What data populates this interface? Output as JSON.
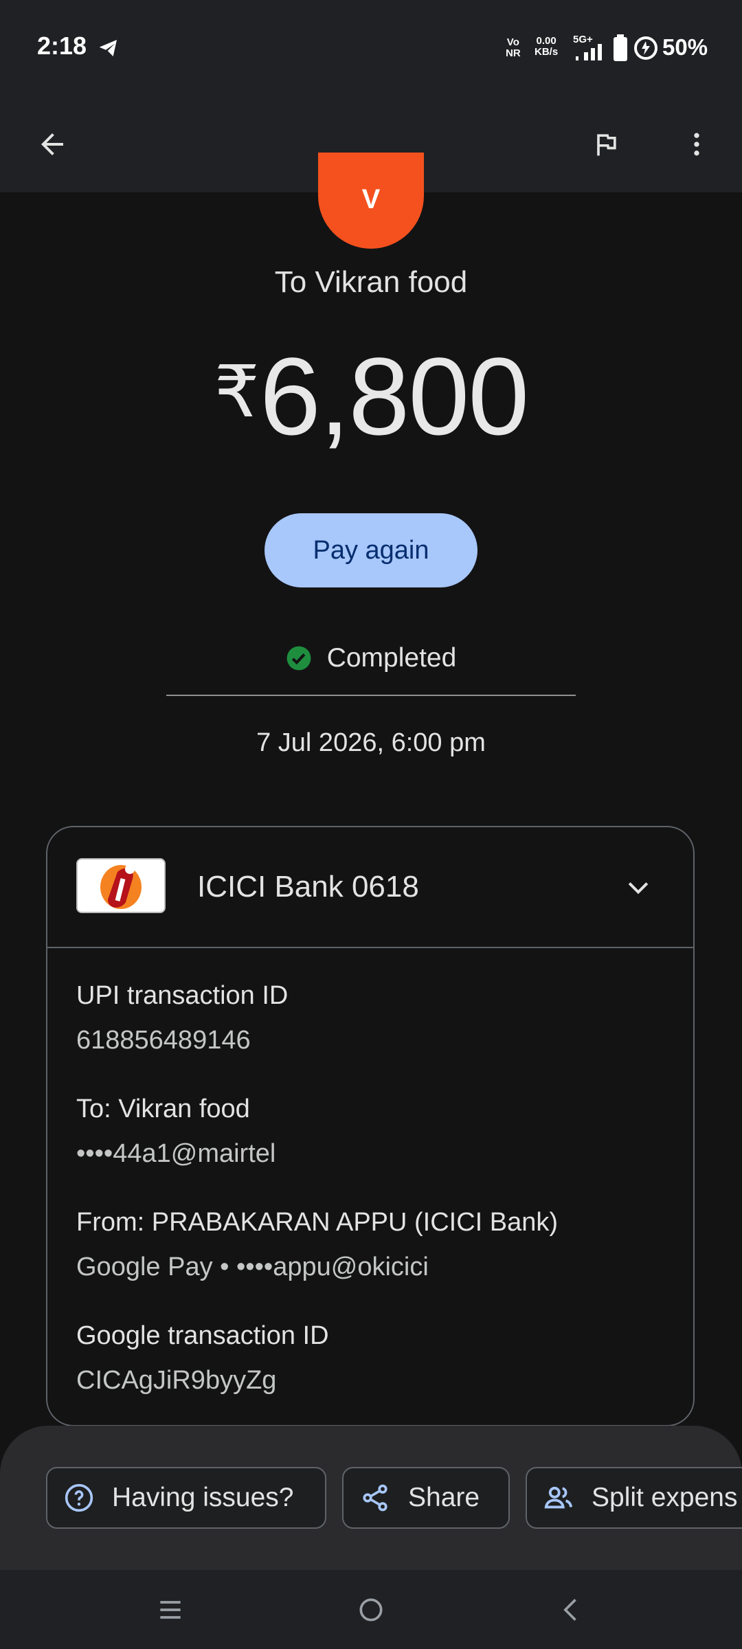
{
  "status_bar": {
    "time": "2:18",
    "network_type_top": "Vo",
    "network_type_bottom": "NR",
    "speed_value": "0.00",
    "speed_unit": "KB/s",
    "signal_label": "5G+",
    "battery_percent": "50%"
  },
  "payment": {
    "avatar_initial": "V",
    "to_label": "To Vikran food",
    "currency_symbol": "₹",
    "amount": "6,800",
    "pay_again_label": "Pay again",
    "status": "Completed",
    "datetime": "7 Jul 2026, 6:00 pm"
  },
  "details_card": {
    "bank_name": "ICICI Bank 0618",
    "items": [
      {
        "label": "UPI transaction ID",
        "value": "618856489146"
      },
      {
        "label": "To: Vikran food",
        "value": "••••44a1@mairtel"
      },
      {
        "label": "From: PRABAKARAN APPU (ICICI Bank)",
        "value": "Google Pay • ••••appu@okicici"
      },
      {
        "label": "Google transaction ID",
        "value": "CICAgJiR9byyZg"
      }
    ]
  },
  "actions": {
    "having_issues": "Having issues?",
    "share": "Share",
    "split": "Split expens"
  },
  "colors": {
    "background": "#131314",
    "bar": "#202124",
    "accent_button": "#a8c7fa",
    "avatar": "#f4511e",
    "success": "#1e8e3e",
    "icon_blue": "#a8c7fa"
  },
  "icons": {
    "back": "arrow-left-icon",
    "report": "flag-icon",
    "menu": "more-vertical-icon",
    "status": "check-circle-icon",
    "expand": "chevron-down-icon",
    "help": "help-circle-icon",
    "share": "share-icon",
    "split": "people-icon"
  }
}
